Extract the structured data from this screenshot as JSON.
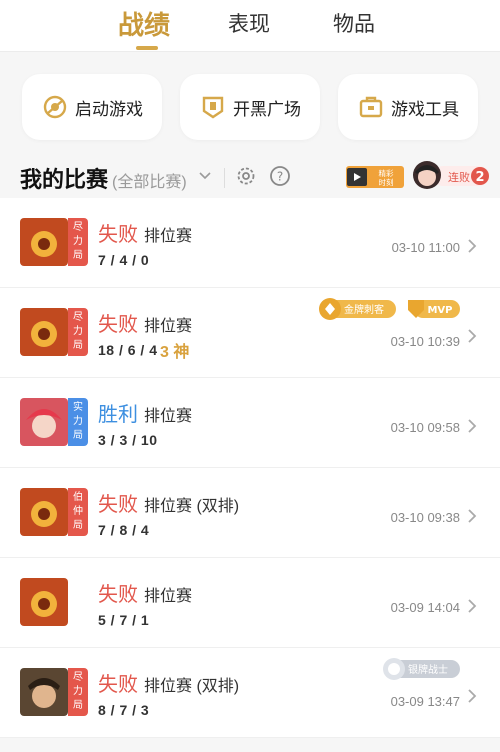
{
  "tabs": [
    "战绩",
    "表现",
    "物品"
  ],
  "quick_actions": [
    {
      "label": "启动游戏",
      "icon": "launch-game-icon"
    },
    {
      "label": "开黑广场",
      "icon": "team-plaza-icon"
    },
    {
      "label": "游戏工具",
      "icon": "toolbox-icon"
    }
  ],
  "section": {
    "title": "我的比赛",
    "filter": "(全部比赛)",
    "highlight_label_1": "精彩",
    "highlight_label_2": "时刻",
    "streak_label": "连败",
    "streak_count": "2"
  },
  "colors": {
    "accent": "#c9993a",
    "loss": "#e2574c",
    "win": "#3d8fe0",
    "tag_red": "#e4574b",
    "tag_blue": "#4b8fe6"
  },
  "matches": [
    {
      "result": "失败",
      "type": "排位赛",
      "kda": "7 / 4 / 0",
      "time": "03-10 11:00",
      "tag": "尽\n力\n局",
      "medals": []
    },
    {
      "result": "失败",
      "type": "排位赛",
      "kda": "18 / 6 / 4",
      "extra": "3 神",
      "time": "03-10 10:39",
      "tag": "尽\n力\n局",
      "medals": [
        "金牌刺客",
        "MVP"
      ]
    },
    {
      "result": "胜利",
      "type": "排位赛",
      "kda": "3 / 3 / 10",
      "time": "03-10 09:58",
      "tag": "实\n力\n局",
      "medals": []
    },
    {
      "result": "失败",
      "type": "排位赛 (双排)",
      "kda": "7 / 8 / 4",
      "time": "03-10 09:38",
      "tag": "伯\n仲\n局",
      "medals": []
    },
    {
      "result": "失败",
      "type": "排位赛",
      "kda": "5 / 7 / 1",
      "time": "03-09 14:04",
      "tag": "",
      "medals": []
    },
    {
      "result": "失败",
      "type": "排位赛 (双排)",
      "kda": "8 / 7 / 3",
      "time": "03-09 13:47",
      "tag": "尽\n力\n局",
      "medals": [
        "银牌战士"
      ]
    }
  ]
}
